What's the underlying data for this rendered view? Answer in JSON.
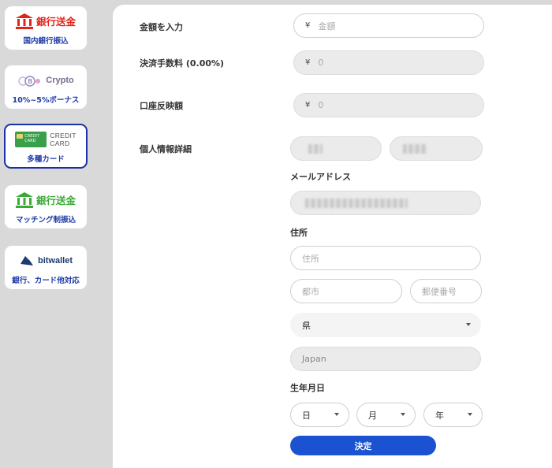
{
  "sidebar": {
    "methods": [
      {
        "logo_text": "銀行送金",
        "caption": "国内銀行振込"
      },
      {
        "logo_text": "Crypto",
        "caption": "10%~5%ボーナス"
      },
      {
        "logo_text_line1": "CREDIT",
        "logo_text_line2": "CARD",
        "card_text": "CREDIT CARD",
        "caption": "多種カード"
      },
      {
        "logo_text": "銀行送金",
        "caption": "マッチング制振込"
      },
      {
        "logo_text": "bitwallet",
        "caption": "銀行、カード他対応"
      }
    ]
  },
  "form": {
    "amount": {
      "label": "金額を入力",
      "currency": "¥",
      "placeholder": "金額"
    },
    "fee": {
      "label": "決済手数料 (0.00%)",
      "currency": "¥",
      "value": "0"
    },
    "reflected": {
      "label": "口座反映額",
      "currency": "¥",
      "value": "0"
    },
    "personal_info_label": "個人情報詳細",
    "email_label": "メールアドレス",
    "address_label": "住所",
    "address_placeholder": "住所",
    "city_placeholder": "都市",
    "postal_placeholder": "郵便番号",
    "prefecture_value": "県",
    "country_value": "Japan",
    "dob_label": "生年月日",
    "dob": {
      "day": "日",
      "month": "月",
      "year": "年"
    },
    "submit_label": "決定"
  },
  "colors": {
    "accent": "#1a52d1",
    "active_border": "#1a2ea8",
    "bank_red": "#e2231a",
    "bank_green": "#3aa935"
  }
}
